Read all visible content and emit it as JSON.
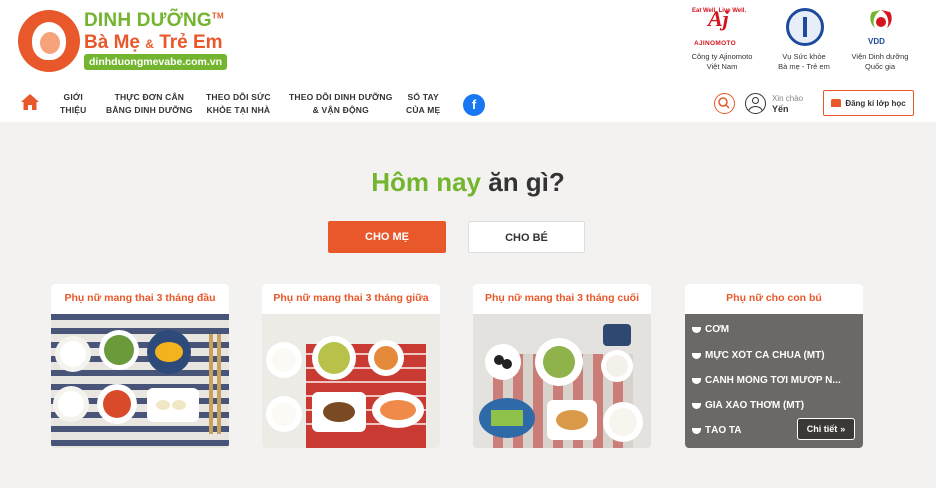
{
  "brand": {
    "line1": "DINH DƯỠNG",
    "tm": "TM",
    "line2_a": "Bà Mẹ",
    "line2_amp": "&",
    "line2_b": "Trẻ Em",
    "url": "dinhduongmevabe.com.vn"
  },
  "partners": [
    {
      "tag": "Eat Well, Live Well.",
      "mark": "Aj",
      "word": "AJINOMOTO",
      "caption1": "Công ty Ajinomoto",
      "caption2": "Việt Nam"
    },
    {
      "caption1": "Vụ Sức khỏe",
      "caption2": "Bà mẹ - Trẻ em"
    },
    {
      "mark": "VDD",
      "caption1": "Viện Dinh dưỡng",
      "caption2": "Quốc gia"
    }
  ],
  "nav": {
    "items": [
      {
        "l1": "GIỚI",
        "l2": "THIỆU"
      },
      {
        "l1": "THỰC ĐƠN CÂN",
        "l2": "BẰNG DINH DƯỠNG"
      },
      {
        "l1": "THEO DÕI SỨC",
        "l2": "KHỎE TẠI NHÀ"
      },
      {
        "l1": "THEO DÕI DINH DƯỠNG",
        "l2": "& VẬN ĐỘNG"
      },
      {
        "l1": "SỔ TAY",
        "l2": "CỦA MẸ"
      }
    ],
    "facebook_glyph": "f",
    "greeting": "Xin chào",
    "username": "Yến",
    "register_label": "Đăng kí lớp học"
  },
  "main": {
    "heading_green": "Hôm nay",
    "heading_dark": "ăn gì?",
    "tab_me": "CHO MẸ",
    "tab_be": "CHO BÉ",
    "cards": [
      {
        "title": "Phụ nữ mang thai 3 tháng đầu"
      },
      {
        "title": "Phụ nữ mang thai 3 tháng giữa"
      },
      {
        "title": "Phụ nữ mang thai 3 tháng cuối"
      },
      {
        "title": "Phụ nữ cho con bú",
        "menu": [
          "CƠM",
          "MỰC XỐT CÀ CHUA (MT)",
          "CANH MỒNG TƠI MƯỚP N...",
          "GIÁ XÀO THƠM (MT)",
          "TÁO TA"
        ],
        "detail_label": "Chi tiết",
        "detail_glyph": "»"
      }
    ]
  },
  "colors": {
    "accent": "#e8582a",
    "green": "#73b52e",
    "bg": "#f3f2f0"
  }
}
